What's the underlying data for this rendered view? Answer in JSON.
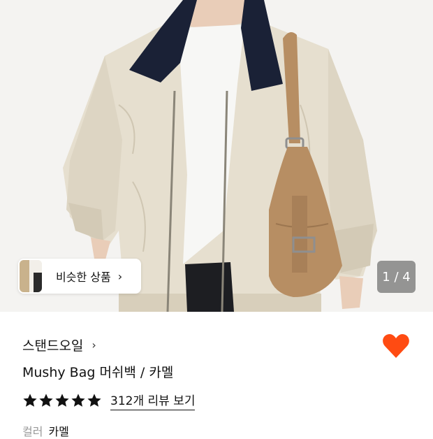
{
  "similar_products": {
    "label": "비슷한 상품",
    "arrow": "›"
  },
  "image_counter": {
    "text": "1 / 4"
  },
  "product": {
    "brand": "스탠드오일",
    "brand_arrow": "›",
    "title": "Mushy Bag 머쉬백 / 카멜",
    "rating_stars": 5,
    "review_link": "312개 리뷰 보기",
    "option_label": "컬러",
    "option_value": "카멜",
    "wishlisted": true
  },
  "colors": {
    "heart": "#ff4b12",
    "bag": "#b78e63",
    "jacket": "#e6dfcf",
    "collar": "#1a2136"
  }
}
